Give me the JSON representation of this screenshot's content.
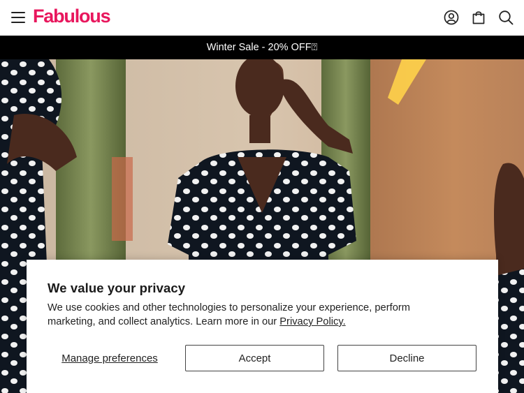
{
  "brand": {
    "logo_text": "Fabulous",
    "accent_color": "#e8175d"
  },
  "header": {
    "icons": [
      "menu-icon",
      "account-icon",
      "bag-icon",
      "search-icon"
    ]
  },
  "promo": {
    "text": "Winter Sale - 20% OFF⍰",
    "background": "#000000"
  },
  "hero": {
    "description_icon": "hero-image"
  },
  "cookie_banner": {
    "title": "We value your privacy",
    "body_text": "We use cookies and other technologies to personalize your experience, perform marketing, and collect analytics. Learn more in our ",
    "policy_link": "Privacy Policy.",
    "manage_label": "Manage preferences",
    "accept_label": "Accept",
    "decline_label": "Decline"
  }
}
